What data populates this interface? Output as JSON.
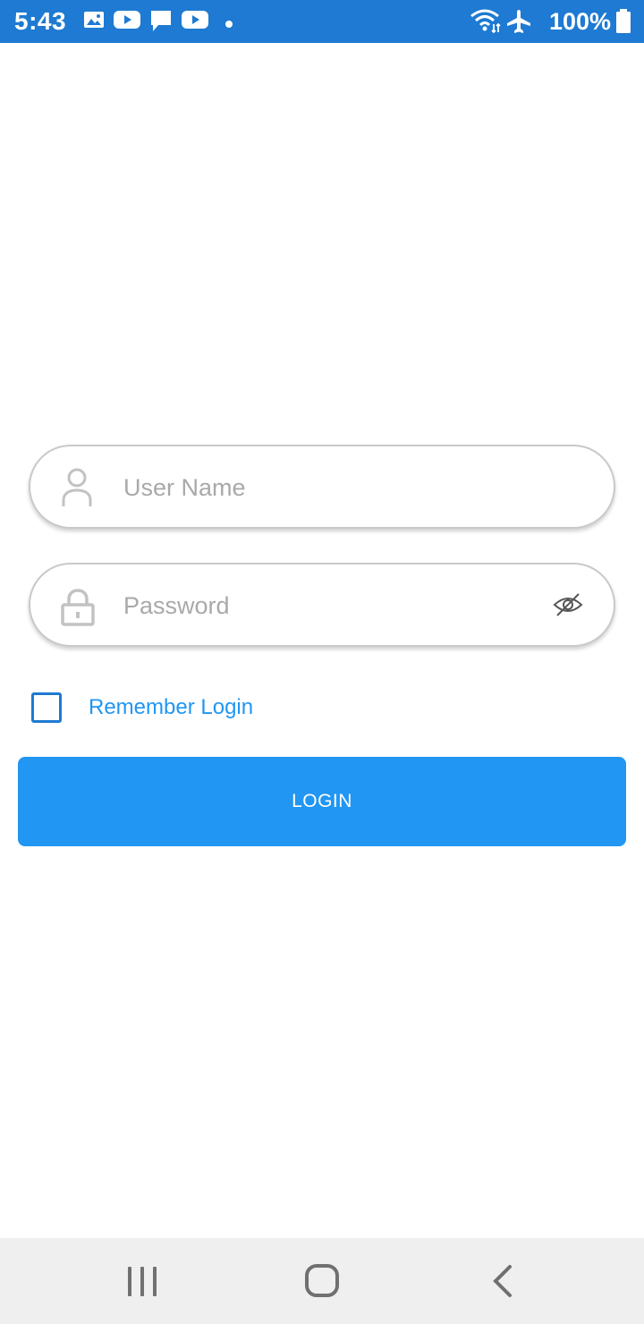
{
  "status_bar": {
    "time": "5:43",
    "battery": "100%",
    "background_color": "#1e7ad2",
    "left_icons": [
      "image-icon",
      "youtube-icon",
      "message-icon",
      "youtube-icon",
      "dot-icon"
    ],
    "right_icons": [
      "wifi-icon",
      "airplane-icon",
      "battery-icon"
    ]
  },
  "login_form": {
    "username": {
      "placeholder": "User Name",
      "value": "",
      "icon": "user-icon"
    },
    "password": {
      "placeholder": "Password",
      "value": "",
      "icon": "lock-icon",
      "toggle_icon": "eye-off-icon"
    },
    "remember": {
      "label": "Remember Login",
      "checked": false
    },
    "login_button": {
      "label": "LOGIN",
      "color": "#2196f3"
    }
  },
  "nav_bar": {
    "buttons": [
      "recents-icon",
      "home-icon",
      "back-icon"
    ]
  }
}
